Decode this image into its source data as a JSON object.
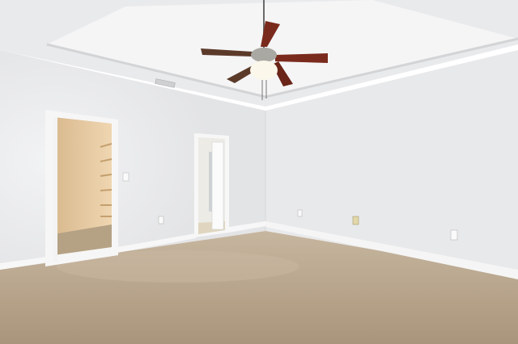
{
  "scene": {
    "caption": "",
    "colors": {
      "wall_left": "#e4e5e7",
      "wall_right": "#e9eaec",
      "ceiling": "#eeeff1",
      "tray": "#f6f6f7",
      "carpet": "#b9a78f",
      "baseboard": "#f7f7f7",
      "closet_interior": "#e2c59c",
      "fan_blade": "#7a2a1c"
    }
  }
}
